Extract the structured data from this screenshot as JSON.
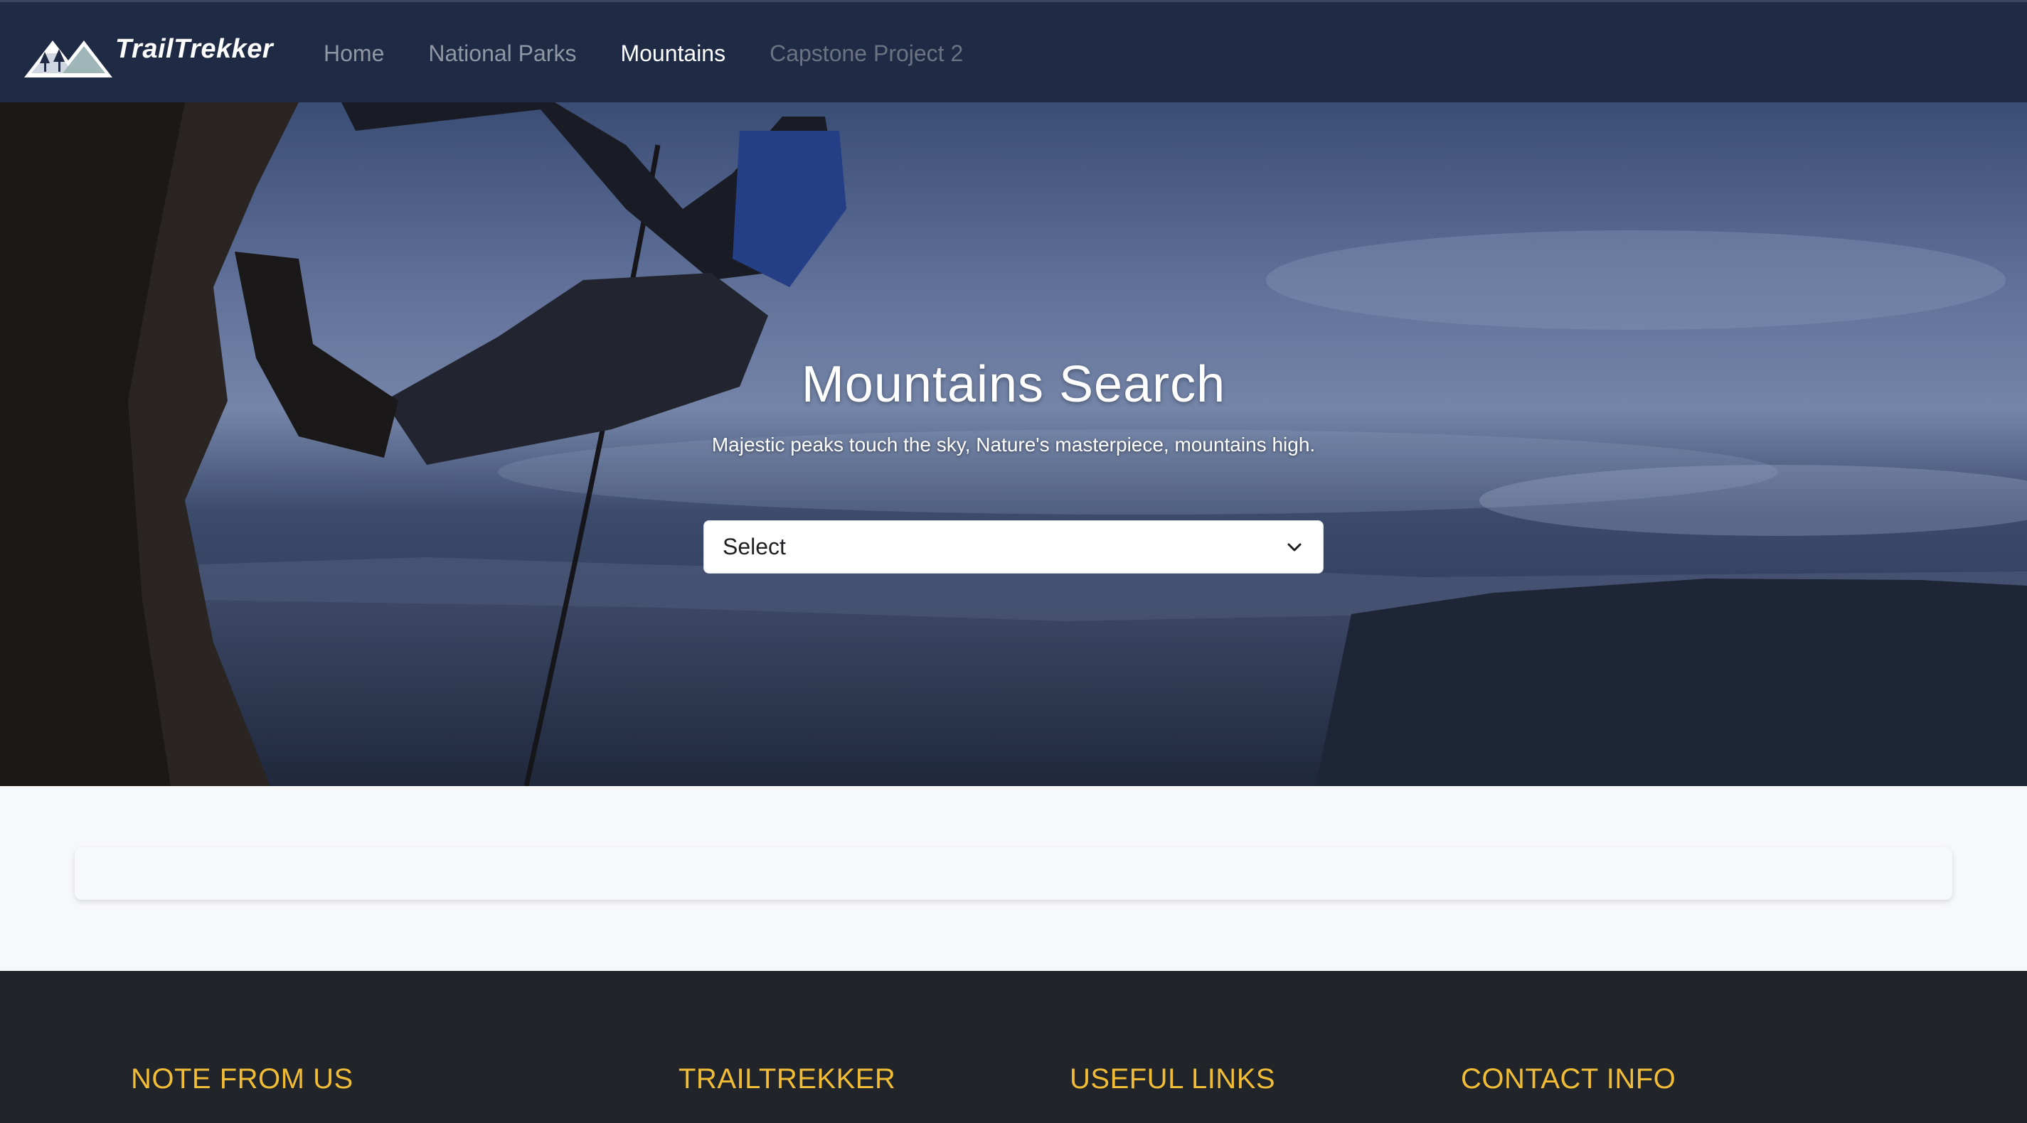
{
  "brand": {
    "name": "TrailTrekker",
    "logo_icon": "mountain-logo-icon"
  },
  "nav": {
    "items": [
      {
        "label": "Home",
        "state": "default"
      },
      {
        "label": "National Parks",
        "state": "default"
      },
      {
        "label": "Mountains",
        "state": "active"
      },
      {
        "label": "Capstone Project 2",
        "state": "muted"
      }
    ]
  },
  "hero": {
    "title": "Mountains Search",
    "subtitle": "Majestic peaks touch the sky, Nature's masterpiece, mountains high.",
    "select": {
      "value": "Select",
      "icon": "chevron-down-icon"
    }
  },
  "footer": {
    "headings": [
      "NOTE FROM US",
      "TRAILTREKKER",
      "USEFUL LINKS",
      "CONTACT INFO"
    ]
  },
  "colors": {
    "navbar": "#1f2b44",
    "footer": "#212429",
    "footer_heading": "#f2bd36",
    "page_bg": "#f7f8fa"
  }
}
